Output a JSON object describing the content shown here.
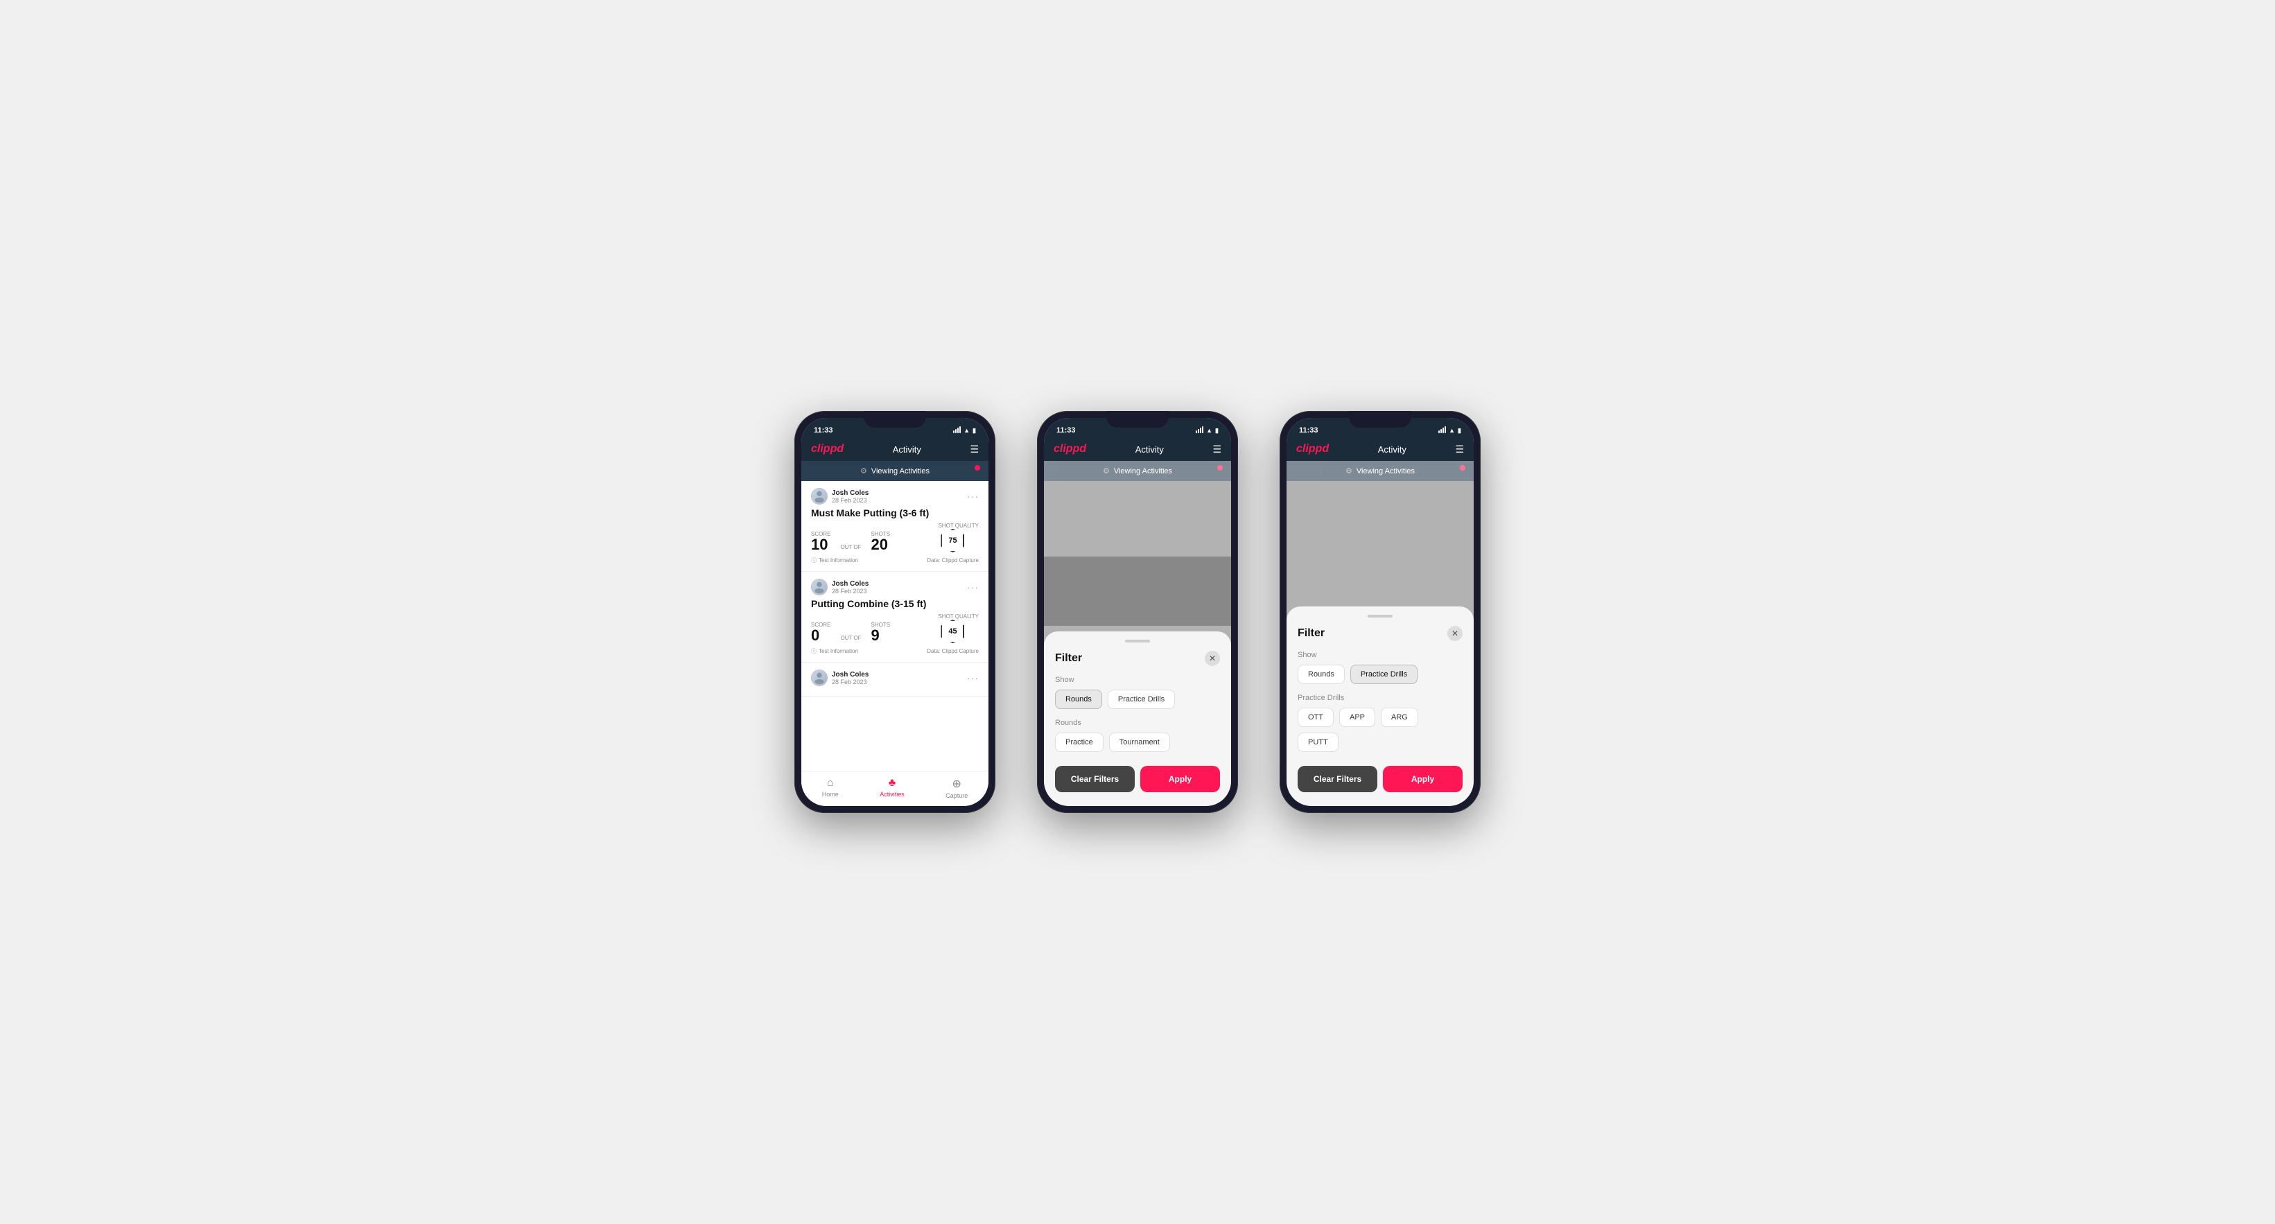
{
  "phones": [
    {
      "id": "phone1",
      "type": "activity",
      "statusBar": {
        "time": "11:33",
        "signal": true,
        "wifi": true,
        "battery": "31"
      },
      "nav": {
        "logo": "clippd",
        "title": "Activity"
      },
      "viewingBar": {
        "text": "Viewing Activities"
      },
      "activities": [
        {
          "userName": "Josh Coles",
          "userDate": "28 Feb 2023",
          "title": "Must Make Putting (3-6 ft)",
          "scoreLbl": "Score",
          "score": "10",
          "outOf": "OUT OF",
          "shotsLbl": "Shots",
          "shots": "20",
          "shotQualityLbl": "Shot Quality",
          "shotQuality": "75",
          "testInfo": "Test Information",
          "dataSource": "Data: Clippd Capture"
        },
        {
          "userName": "Josh Coles",
          "userDate": "28 Feb 2023",
          "title": "Putting Combine (3-15 ft)",
          "scoreLbl": "Score",
          "score": "0",
          "outOf": "OUT OF",
          "shotsLbl": "Shots",
          "shots": "9",
          "shotQualityLbl": "Shot Quality",
          "shotQuality": "45",
          "testInfo": "Test Information",
          "dataSource": "Data: Clippd Capture"
        },
        {
          "userName": "Josh Coles",
          "userDate": "28 Feb 2023",
          "title": "",
          "scoreLbl": "",
          "score": "",
          "outOf": "",
          "shotsLbl": "",
          "shots": "",
          "shotQualityLbl": "",
          "shotQuality": "",
          "testInfo": "",
          "dataSource": ""
        }
      ],
      "bottomNav": [
        {
          "label": "Home",
          "icon": "⌂",
          "active": false
        },
        {
          "label": "Activities",
          "icon": "♣",
          "active": true
        },
        {
          "label": "Capture",
          "icon": "+",
          "active": false
        }
      ]
    },
    {
      "id": "phone2",
      "type": "filter-rounds",
      "statusBar": {
        "time": "11:33",
        "signal": true,
        "wifi": true,
        "battery": "31"
      },
      "nav": {
        "logo": "clippd",
        "title": "Activity"
      },
      "viewingBar": {
        "text": "Viewing Activities"
      },
      "filter": {
        "title": "Filter",
        "showLabel": "Show",
        "showButtons": [
          {
            "label": "Rounds",
            "active": true
          },
          {
            "label": "Practice Drills",
            "active": false
          }
        ],
        "roundsLabel": "Rounds",
        "roundsButtons": [
          {
            "label": "Practice",
            "active": false
          },
          {
            "label": "Tournament",
            "active": false
          }
        ],
        "clearFilters": "Clear Filters",
        "apply": "Apply"
      }
    },
    {
      "id": "phone3",
      "type": "filter-practice",
      "statusBar": {
        "time": "11:33",
        "signal": true,
        "wifi": true,
        "battery": "31"
      },
      "nav": {
        "logo": "clippd",
        "title": "Activity"
      },
      "viewingBar": {
        "text": "Viewing Activities"
      },
      "filter": {
        "title": "Filter",
        "showLabel": "Show",
        "showButtons": [
          {
            "label": "Rounds",
            "active": false
          },
          {
            "label": "Practice Drills",
            "active": true
          }
        ],
        "practiceLabel": "Practice Drills",
        "practiceButtons": [
          {
            "label": "OTT",
            "active": false
          },
          {
            "label": "APP",
            "active": false
          },
          {
            "label": "ARG",
            "active": false
          },
          {
            "label": "PUTT",
            "active": false
          }
        ],
        "clearFilters": "Clear Filters",
        "apply": "Apply"
      }
    }
  ]
}
